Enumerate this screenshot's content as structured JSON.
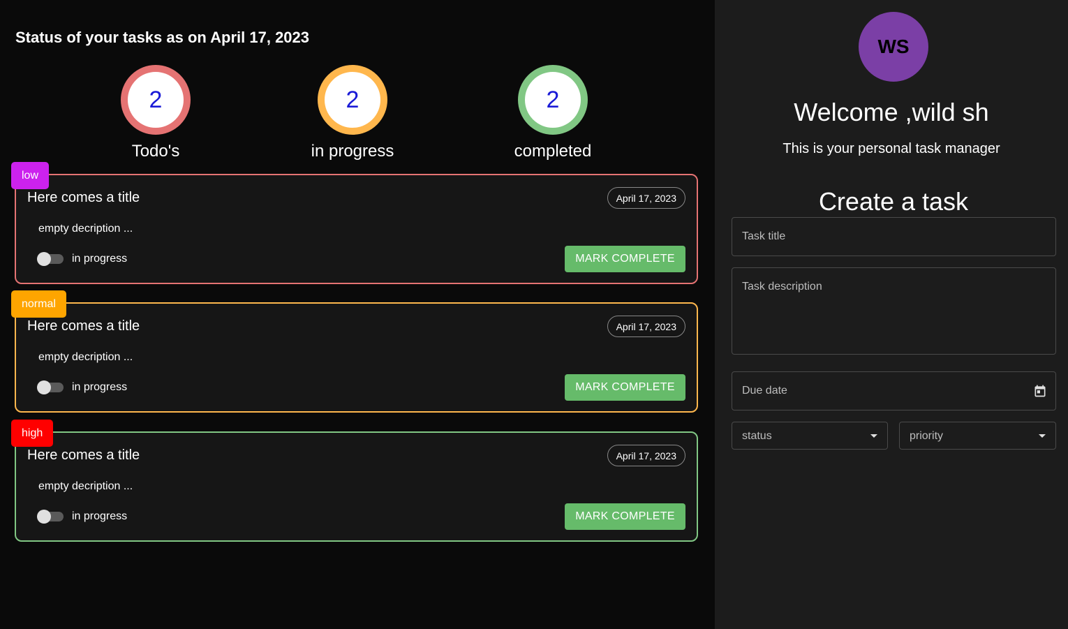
{
  "dashboard": {
    "heading": "Status of your tasks as on April 17, 2023",
    "stats": [
      {
        "count": "2",
        "label": "Todo's",
        "color": "#e57373"
      },
      {
        "count": "2",
        "label": "in progress",
        "color": "#ffb74d"
      },
      {
        "count": "2",
        "label": "completed",
        "color": "#81c784"
      }
    ]
  },
  "tasks": [
    {
      "priority": "low",
      "title": "Here comes a title",
      "date": "April 17, 2023",
      "description": "empty decription ...",
      "status_label": "in progress",
      "button": "MARK COMPLETE",
      "border_color": "#e57373",
      "tag_color": "#cc22ee"
    },
    {
      "priority": "normal",
      "title": "Here comes a title",
      "date": "April 17, 2023",
      "description": "empty decription ...",
      "status_label": "in progress",
      "button": "MARK COMPLETE",
      "border_color": "#ffb74d",
      "tag_color": "#ffa500"
    },
    {
      "priority": "high",
      "title": "Here comes a title",
      "date": "April 17, 2023",
      "description": "empty decription ...",
      "status_label": "in progress",
      "button": "MARK COMPLETE",
      "border_color": "#81c784",
      "tag_color": "#ff0000"
    }
  ],
  "sidebar": {
    "avatar_initials": "WS",
    "avatar_color": "#7b3fa6",
    "welcome": "Welcome ,wild sh",
    "subtitle": "This is your personal task manager",
    "create_heading": "Create a task",
    "form": {
      "title_placeholder": "Task title",
      "description_placeholder": "Task description",
      "due_date_placeholder": "Due date",
      "status_placeholder": "status",
      "priority_placeholder": "priority",
      "calendar_icon": "calendar-icon"
    }
  },
  "colors": {
    "button_green": "#66bb6a",
    "count_blue": "#1a1ad6"
  }
}
